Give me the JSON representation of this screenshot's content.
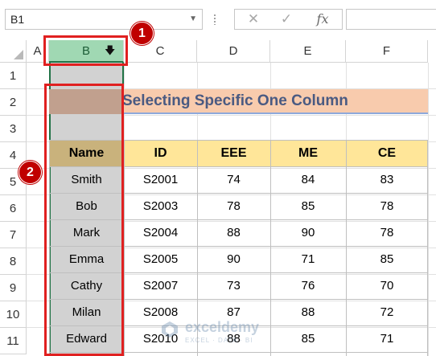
{
  "formula_bar": {
    "name_box": "B1",
    "cancel_icon": "✕",
    "enter_icon": "✓",
    "fx_label": "fx",
    "formula": ""
  },
  "columns": [
    "A",
    "B",
    "C",
    "D",
    "E",
    "F"
  ],
  "rows": [
    "1",
    "2",
    "3",
    "4",
    "5",
    "6",
    "7",
    "8",
    "9",
    "10",
    "11"
  ],
  "sheet": {
    "title": "Selecting Specific One Column",
    "headers": [
      "Name",
      "ID",
      "EEE",
      "ME",
      "CE"
    ],
    "data": [
      [
        "Smith",
        "S2001",
        "74",
        "84",
        "83"
      ],
      [
        "Bob",
        "S2003",
        "78",
        "85",
        "78"
      ],
      [
        "Mark",
        "S2004",
        "88",
        "90",
        "78"
      ],
      [
        "Emma",
        "S2005",
        "90",
        "71",
        "85"
      ],
      [
        "Cathy",
        "S2007",
        "73",
        "76",
        "70"
      ],
      [
        "Milan",
        "S2008",
        "87",
        "88",
        "72"
      ],
      [
        "Edward",
        "S2010",
        "88",
        "85",
        "71"
      ]
    ]
  },
  "callouts": {
    "step1": "1",
    "step2": "2"
  },
  "watermark": {
    "name": "exceldemy",
    "tagline": "EXCEL · DATA · BI"
  },
  "colors": {
    "selected_column": "#d2d2d2",
    "selected_header": "#a0d8b3",
    "title_fill": "#f8cbad",
    "header_fill": "#ffe699",
    "callout_red": "#c00000"
  },
  "icons": {
    "select_column_cursor": "down-arrow-icon"
  }
}
